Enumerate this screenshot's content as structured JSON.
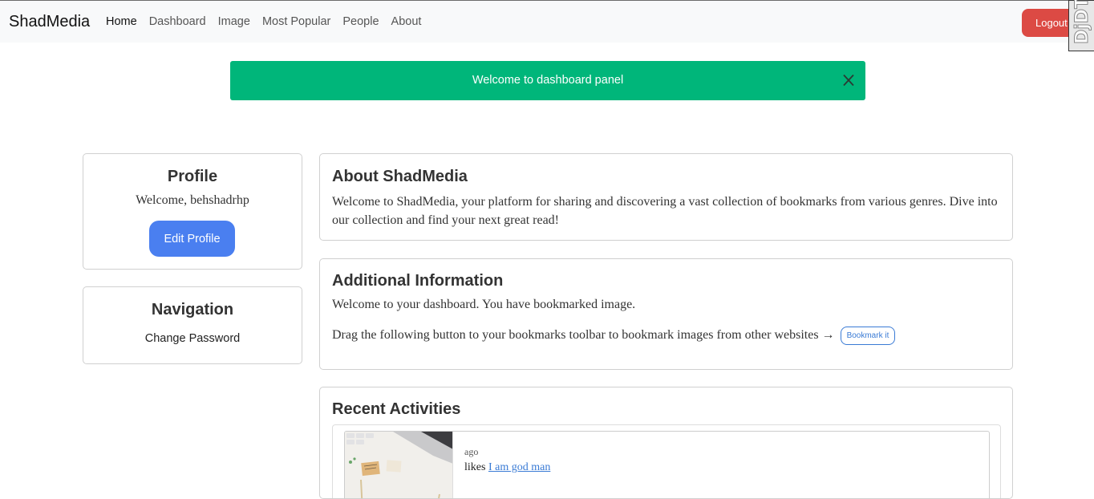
{
  "navbar": {
    "brand": "ShadMedia",
    "links": [
      {
        "label": "Home",
        "active": true
      },
      {
        "label": "Dashboard",
        "active": false
      },
      {
        "label": "Image",
        "active": false
      },
      {
        "label": "Most Popular",
        "active": false
      },
      {
        "label": "People",
        "active": false
      },
      {
        "label": "About",
        "active": false
      }
    ],
    "logout_label": "Logout",
    "debug_toolbar_label": "DjDT"
  },
  "alert": {
    "message": "Welcome to dashboard panel",
    "color": "#00b67a"
  },
  "profile": {
    "title": "Profile",
    "welcome": "Welcome, behshadrhp",
    "edit_label": "Edit Profile"
  },
  "navigation": {
    "title": "Navigation",
    "change_password_label": "Change Password"
  },
  "about": {
    "title": "About ShadMedia",
    "text": "Welcome to ShadMedia, your platform for sharing and discovering a vast collection of bookmarks from various genres. Dive into our collection and find your next great read!"
  },
  "additional": {
    "title": "Additional Information",
    "line1": "Welcome to your dashboard. You have bookmarked image.",
    "line2": "Drag the following button to your bookmarks toolbar to bookmark images from other websites →",
    "bookmark_label": "Bookmark it"
  },
  "recent": {
    "title": "Recent Activities",
    "items": [
      {
        "time": "ago",
        "verb": "likes",
        "target": "I am god man"
      }
    ]
  },
  "colors": {
    "accent": "#4a7ff0",
    "danger": "#dc4a44",
    "success": "#00b67a"
  }
}
